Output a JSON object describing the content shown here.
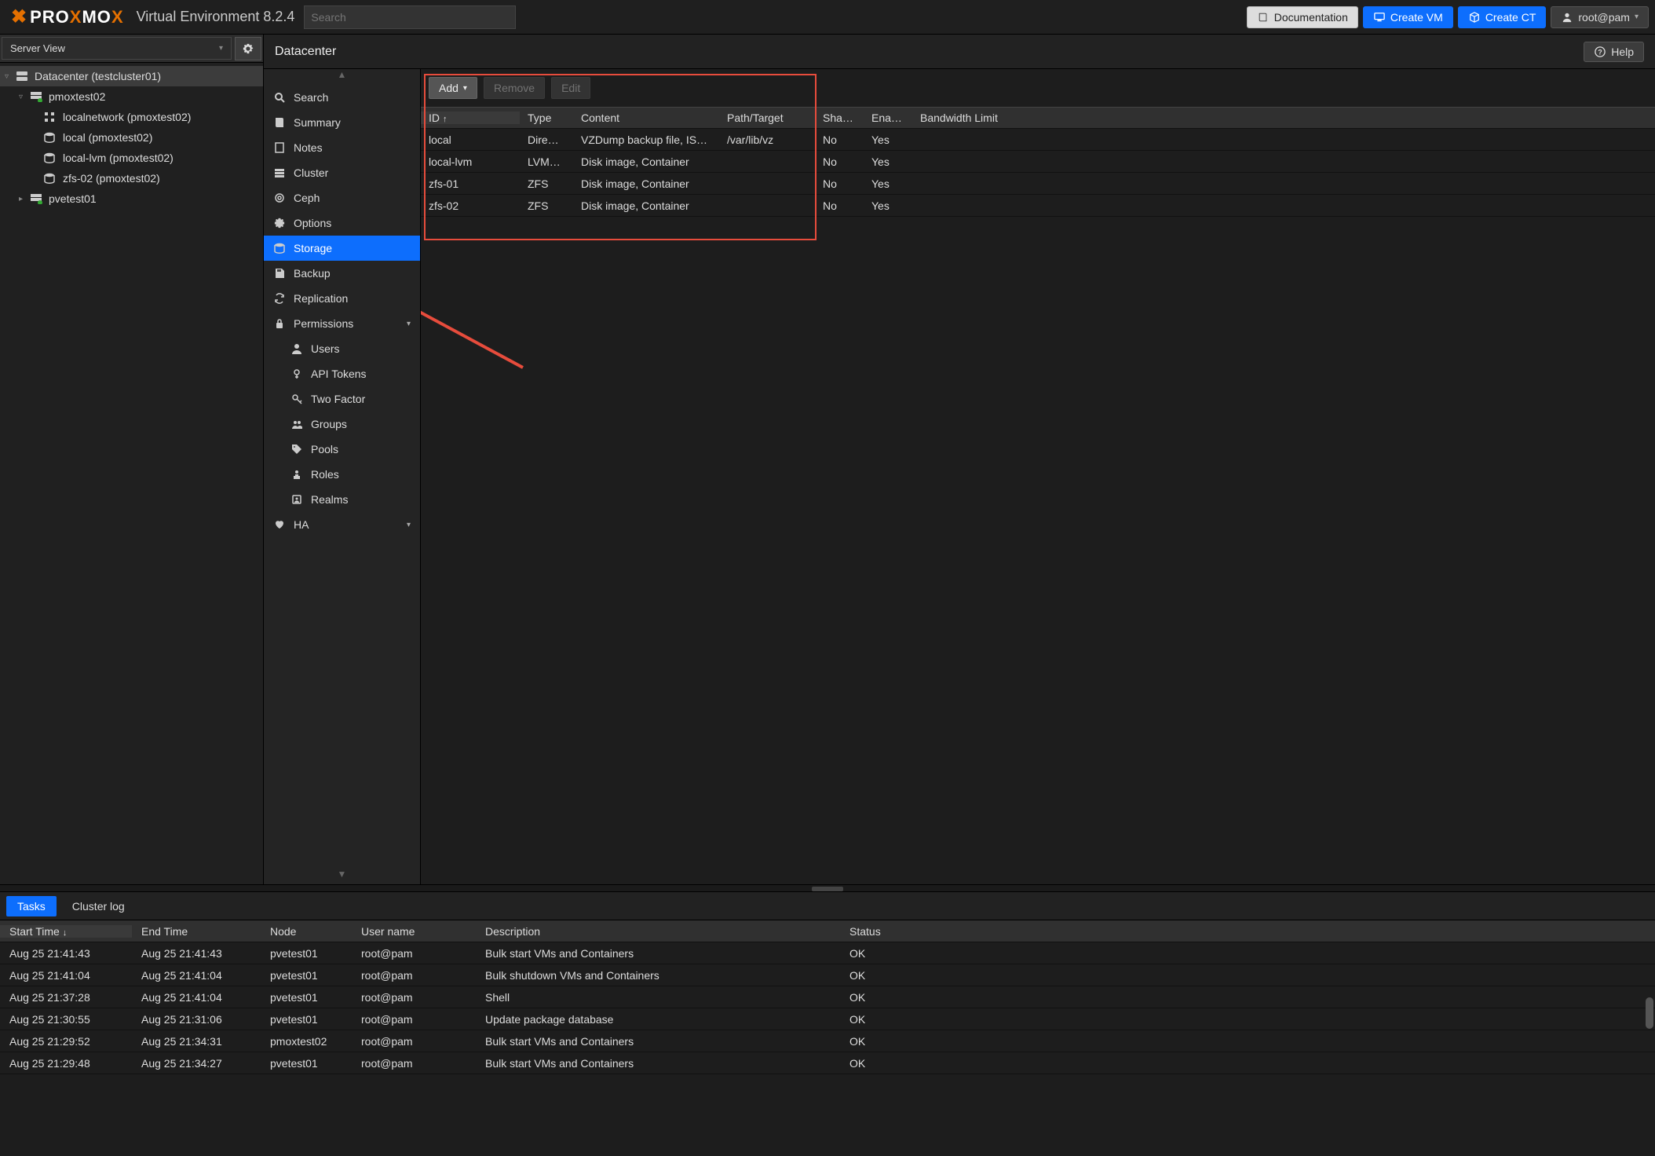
{
  "header": {
    "product": "PROXMOX",
    "product_html": [
      "PRO",
      "X",
      "MO",
      "X"
    ],
    "subtitle": "Virtual Environment 8.2.4",
    "search_placeholder": "Search",
    "buttons": {
      "doc": "Documentation",
      "create_vm": "Create VM",
      "create_ct": "Create CT",
      "user": "root@pam"
    }
  },
  "tree": {
    "view_label": "Server View",
    "nodes": [
      {
        "indent": 0,
        "arrow": "▿",
        "icon": "server",
        "label": "Datacenter (testcluster01)",
        "selected": true
      },
      {
        "indent": 1,
        "arrow": "▿",
        "icon": "node",
        "label": "pmoxtest02"
      },
      {
        "indent": 2,
        "arrow": "",
        "icon": "net",
        "label": "localnetwork (pmoxtest02)"
      },
      {
        "indent": 2,
        "arrow": "",
        "icon": "db",
        "label": "local (pmoxtest02)"
      },
      {
        "indent": 2,
        "arrow": "",
        "icon": "db",
        "label": "local-lvm (pmoxtest02)"
      },
      {
        "indent": 2,
        "arrow": "",
        "icon": "db",
        "label": "zfs-02 (pmoxtest02)"
      },
      {
        "indent": 1,
        "arrow": "▸",
        "icon": "node",
        "label": "pvetest01"
      }
    ]
  },
  "breadcrumb": {
    "title": "Datacenter",
    "help": "Help"
  },
  "nav": [
    {
      "icon": "search",
      "label": "Search"
    },
    {
      "icon": "book",
      "label": "Summary"
    },
    {
      "icon": "note",
      "label": "Notes"
    },
    {
      "icon": "cluster",
      "label": "Cluster"
    },
    {
      "icon": "ceph",
      "label": "Ceph"
    },
    {
      "icon": "gear",
      "label": "Options"
    },
    {
      "icon": "db",
      "label": "Storage",
      "active": true
    },
    {
      "icon": "save",
      "label": "Backup"
    },
    {
      "icon": "repl",
      "label": "Replication"
    },
    {
      "icon": "lock",
      "label": "Permissions",
      "expandable": true
    },
    {
      "icon": "user",
      "label": "Users",
      "sub": true
    },
    {
      "icon": "token",
      "label": "API Tokens",
      "sub": true
    },
    {
      "icon": "key",
      "label": "Two Factor",
      "sub": true
    },
    {
      "icon": "group",
      "label": "Groups",
      "sub": true
    },
    {
      "icon": "tag",
      "label": "Pools",
      "sub": true
    },
    {
      "icon": "role",
      "label": "Roles",
      "sub": true
    },
    {
      "icon": "realm",
      "label": "Realms",
      "sub": true
    },
    {
      "icon": "ha",
      "label": "HA",
      "expandable": true
    }
  ],
  "storage": {
    "toolbar": {
      "add": "Add",
      "remove": "Remove",
      "edit": "Edit"
    },
    "columns": {
      "id": "ID",
      "type": "Type",
      "content": "Content",
      "path": "Path/Target",
      "shared": "Sha…",
      "enabled": "Ena…",
      "bw": "Bandwidth Limit"
    },
    "rows": [
      {
        "id": "local",
        "type": "Dire…",
        "content": "VZDump backup file, IS…",
        "path": "/var/lib/vz",
        "shared": "No",
        "enabled": "Yes",
        "bw": ""
      },
      {
        "id": "local-lvm",
        "type": "LVM…",
        "content": "Disk image, Container",
        "path": "",
        "shared": "No",
        "enabled": "Yes",
        "bw": ""
      },
      {
        "id": "zfs-01",
        "type": "ZFS",
        "content": "Disk image, Container",
        "path": "",
        "shared": "No",
        "enabled": "Yes",
        "bw": ""
      },
      {
        "id": "zfs-02",
        "type": "ZFS",
        "content": "Disk image, Container",
        "path": "",
        "shared": "No",
        "enabled": "Yes",
        "bw": ""
      }
    ]
  },
  "tasks": {
    "tabs": {
      "tasks": "Tasks",
      "log": "Cluster log"
    },
    "columns": {
      "start": "Start Time",
      "end": "End Time",
      "node": "Node",
      "user": "User name",
      "desc": "Description",
      "status": "Status"
    },
    "rows": [
      {
        "start": "Aug 25 21:41:43",
        "end": "Aug 25 21:41:43",
        "node": "pvetest01",
        "user": "root@pam",
        "desc": "Bulk start VMs and Containers",
        "status": "OK"
      },
      {
        "start": "Aug 25 21:41:04",
        "end": "Aug 25 21:41:04",
        "node": "pvetest01",
        "user": "root@pam",
        "desc": "Bulk shutdown VMs and Containers",
        "status": "OK"
      },
      {
        "start": "Aug 25 21:37:28",
        "end": "Aug 25 21:41:04",
        "node": "pvetest01",
        "user": "root@pam",
        "desc": "Shell",
        "status": "OK"
      },
      {
        "start": "Aug 25 21:30:55",
        "end": "Aug 25 21:31:06",
        "node": "pvetest01",
        "user": "root@pam",
        "desc": "Update package database",
        "status": "OK"
      },
      {
        "start": "Aug 25 21:29:52",
        "end": "Aug 25 21:34:31",
        "node": "pmoxtest02",
        "user": "root@pam",
        "desc": "Bulk start VMs and Containers",
        "status": "OK"
      },
      {
        "start": "Aug 25 21:29:48",
        "end": "Aug 25 21:34:27",
        "node": "pvetest01",
        "user": "root@pam",
        "desc": "Bulk start VMs and Containers",
        "status": "OK"
      }
    ]
  }
}
